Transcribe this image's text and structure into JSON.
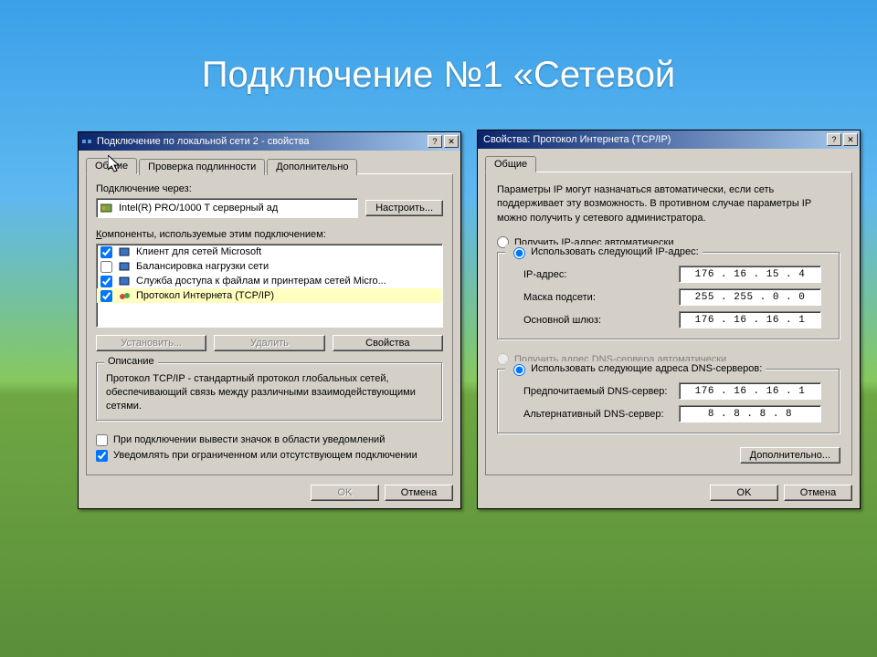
{
  "slide": {
    "title": "Подключение №1 «Сетевой"
  },
  "dlg1": {
    "title": "Подключение по локальной сети 2 - свойства",
    "tabs": {
      "general": "Общие",
      "auth": "Проверка подлинности",
      "advanced": "Дополнительно"
    },
    "connect_via": "Подключение через:",
    "adapter": "Intel(R) PRO/1000 T серверный ад",
    "configure": "Настроить...",
    "components_label": "Компоненты, используемые этим подключением:",
    "components": [
      {
        "checked": true,
        "label": "Клиент для сетей Microsoft"
      },
      {
        "checked": false,
        "label": "Балансировка нагрузки сети"
      },
      {
        "checked": true,
        "label": "Служба доступа к файлам и принтерам сетей Micro..."
      },
      {
        "checked": true,
        "label": "Протокол Интернета (TCP/IP)"
      }
    ],
    "install": "Установить...",
    "uninstall": "Удалить",
    "properties": "Свойства",
    "desc_title": "Описание",
    "desc_text": "Протокол TCP/IP - стандартный протокол глобальных сетей, обеспечивающий связь между различными взаимодействующими сетями.",
    "tray_chk": "При подключении вывести значок в области уведомлений",
    "notify_chk": "Уведомлять при ограниченном или отсутствующем подключении",
    "ok": "OK",
    "cancel": "Отмена"
  },
  "dlg2": {
    "title": "Свойства: Протокол Интернета (TCP/IP)",
    "tab_general": "Общие",
    "info_text": "Параметры IP могут назначаться автоматически, если сеть поддерживает эту возможность. В противном случае параметры IP можно получить у сетевого администратора.",
    "radio_auto_ip": "Получить IP-адрес автоматически",
    "radio_manual_ip": "Использовать следующий IP-адрес:",
    "ip_label": "IP-адрес:",
    "mask_label": "Маска подсети:",
    "gw_label": "Основной шлюз:",
    "ip_value": "176 . 16 . 15 . 4",
    "mask_value": "255 . 255 .  0  .  0",
    "gw_value": "176 . 16 . 16 . 1",
    "radio_auto_dns": "Получить адрес DNS-сервера автоматически",
    "radio_manual_dns": "Использовать следующие адреса DNS-серверов:",
    "dns1_label": "Предпочитаемый DNS-сервер:",
    "dns2_label": "Альтернативный DNS-сервер:",
    "dns1_value": "176 . 16 . 16 . 1",
    "dns2_value": "8 . 8 . 8 . 8",
    "advanced": "Дополнительно...",
    "ok": "OK",
    "cancel": "Отмена"
  }
}
